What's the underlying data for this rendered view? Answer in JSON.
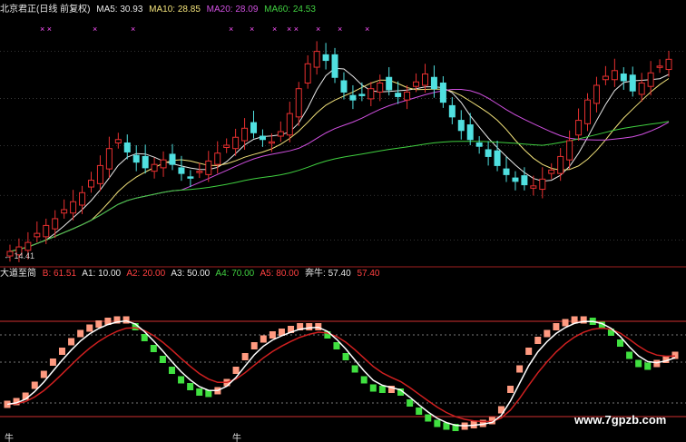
{
  "title": "北京君正(日线 前复权)",
  "ma_labels": [
    {
      "text": "MA5: 30.93",
      "color": "#e8e8e8"
    },
    {
      "text": "MA10: 28.85",
      "color": "#f2e27a"
    },
    {
      "text": "MA20: 28.09",
      "color": "#d050e0"
    },
    {
      "text": "MA60: 24.53",
      "color": "#40d040"
    }
  ],
  "low_label": "← 14.41",
  "indicator": {
    "name": "大道至简",
    "items": [
      {
        "text": "B: 61.51",
        "color": "#ff4040"
      },
      {
        "text": "A1: 10.00",
        "color": "#e8e8e8"
      },
      {
        "text": "A2: 20.00",
        "color": "#ff4040"
      },
      {
        "text": "A3: 50.00",
        "color": "#e8e8e8"
      },
      {
        "text": "A4: 70.00",
        "color": "#40d040"
      },
      {
        "text": "A5: 80.00",
        "color": "#ff4040"
      },
      {
        "text": "奔牛: 57.40",
        "color": "#e8e8e8"
      },
      {
        "text": "57.40",
        "color": "#ff4040"
      }
    ]
  },
  "markers": "× ×",
  "niu_label": "牛",
  "watermark": "www.7gpzb.com",
  "chart_data": [
    {
      "type": "candlestick",
      "title": "北京君正(日线 前复权)",
      "ylim": [
        14,
        36
      ],
      "closes": [
        15.2,
        15.6,
        16.0,
        16.8,
        17.5,
        18.1,
        18.9,
        19.6,
        20.4,
        21.5,
        22.8,
        24.3,
        25.1,
        24.0,
        23.1,
        22.6,
        22.9,
        23.3,
        22.9,
        22.1,
        21.7,
        22.3,
        23.2,
        23.9,
        24.6,
        25.3,
        26.1,
        25.7,
        25.1,
        24.9,
        25.8,
        27.4,
        29.6,
        31.8,
        32.9,
        32.1,
        30.6,
        29.3,
        28.6,
        29.0,
        29.6,
        30.1,
        29.5,
        28.9,
        29.3,
        30.2,
        30.9,
        29.6,
        28.4,
        27.1,
        25.9,
        25.1,
        24.5,
        23.6,
        22.8,
        22.0,
        21.4,
        21.1,
        21.0,
        21.6,
        22.4,
        23.6,
        25.0,
        26.8,
        28.6,
        29.9,
        30.7,
        31.2,
        30.3,
        29.4,
        30.1,
        31.0,
        31.6,
        32.2
      ],
      "up_color": "#e83030",
      "down_color": "#50e0e0",
      "ma_series": [
        {
          "name": "MA5",
          "color": "#e8e8e8",
          "window": 5
        },
        {
          "name": "MA10",
          "color": "#f2e27a",
          "window": 10
        },
        {
          "name": "MA20",
          "color": "#d050e0",
          "window": 20
        },
        {
          "name": "MA60",
          "color": "#40d040",
          "window": 60
        }
      ],
      "grid": "dotted-horizontal"
    },
    {
      "type": "bar",
      "title": "大道至简",
      "ylim": [
        0,
        100
      ],
      "reference_lines": [
        {
          "value": 10,
          "color": "#d03030"
        },
        {
          "value": 20,
          "color": "#777777"
        },
        {
          "value": 50,
          "color": "#777777"
        },
        {
          "value": 70,
          "color": "#777777"
        },
        {
          "value": 80,
          "color": "#d03030"
        }
      ],
      "x": [
        0,
        2,
        4,
        6,
        8,
        10,
        12,
        14,
        16,
        18,
        20,
        22,
        24,
        26,
        28,
        30,
        32,
        34,
        36,
        38,
        40,
        42,
        44,
        46,
        48,
        50,
        52,
        54,
        56,
        58,
        60,
        62,
        64,
        66,
        68,
        70,
        72,
        74,
        76,
        78,
        80,
        82,
        84,
        86,
        88,
        90,
        92,
        94,
        96,
        98,
        100,
        102,
        104,
        106,
        108,
        110,
        112,
        114,
        116,
        118,
        120,
        122,
        124,
        126,
        128,
        130,
        132,
        134,
        136,
        138,
        140,
        142,
        144,
        146
      ],
      "values": [
        19,
        21,
        25,
        33,
        41,
        50,
        58,
        65,
        71,
        75,
        78,
        80,
        81,
        81,
        76,
        68,
        60,
        52,
        44,
        37,
        32,
        28,
        27,
        29,
        35,
        44,
        54,
        62,
        67,
        70,
        72,
        74,
        76,
        76,
        76,
        70,
        62,
        54,
        45,
        37,
        31,
        30,
        30,
        28,
        20,
        14,
        9,
        5,
        3,
        2,
        3,
        4,
        5,
        7,
        15,
        30,
        45,
        58,
        66,
        71,
        76,
        79,
        81,
        81,
        80,
        77,
        72,
        64,
        55,
        49,
        47,
        49,
        52,
        55
      ],
      "values_colored": "rising=#ff9a80, falling=#40e040",
      "lines": [
        {
          "name": "奔牛",
          "color": "#ffffff"
        },
        {
          "name": "B",
          "color": "#d02020"
        }
      ]
    }
  ]
}
